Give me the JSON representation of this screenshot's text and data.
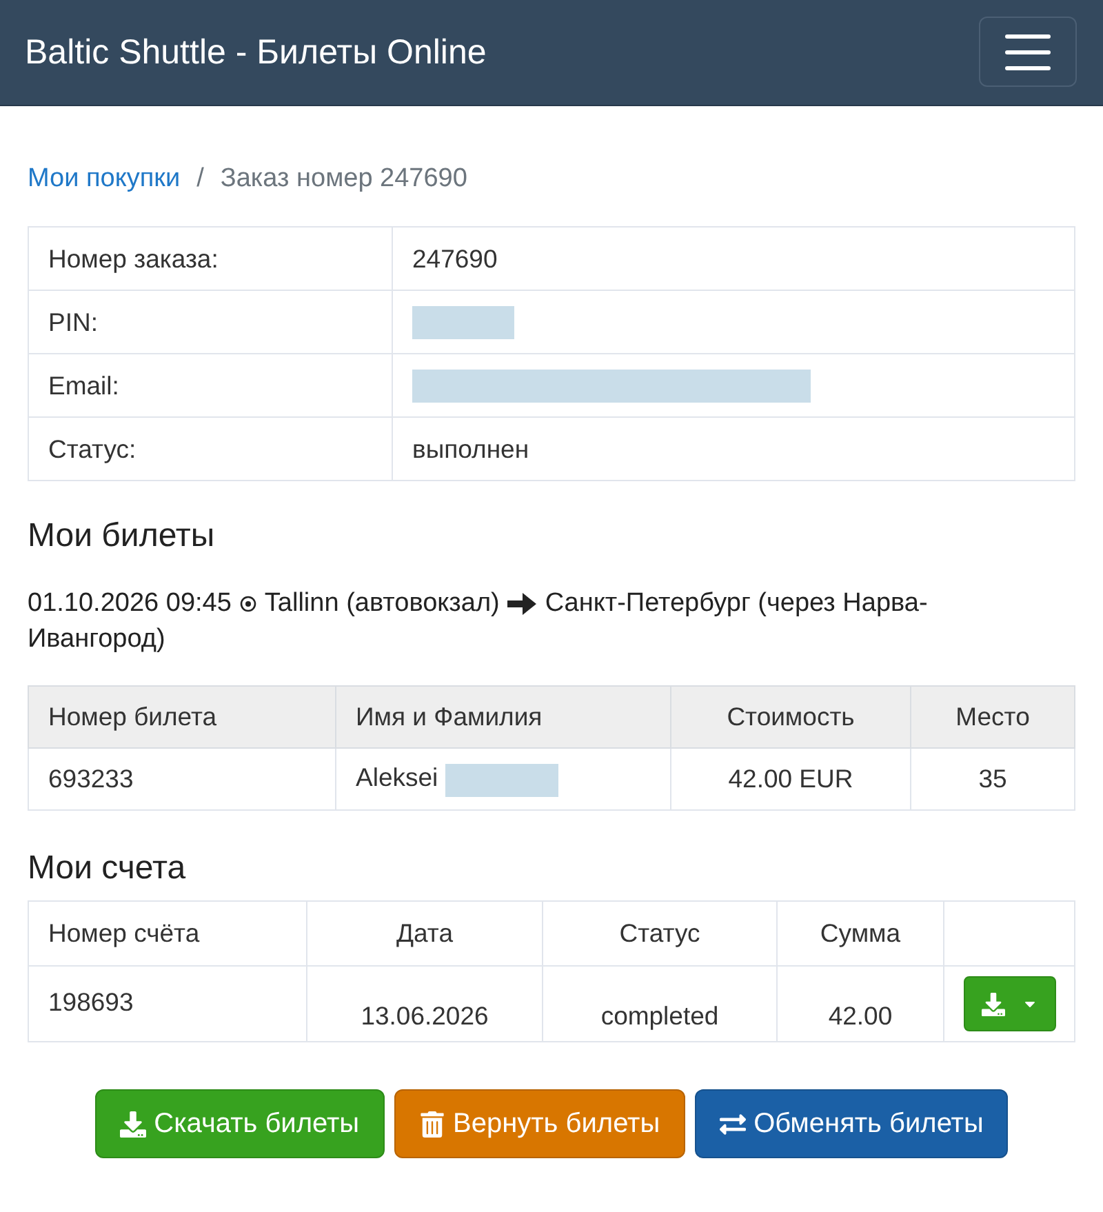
{
  "navbar": {
    "brand": "Baltic Shuttle - Билеты Online"
  },
  "breadcrumb": {
    "separator": "/",
    "items": [
      {
        "label": "Мои покупки",
        "kind": "link"
      },
      {
        "label": "Заказ номер 247690",
        "kind": "current"
      }
    ]
  },
  "order_info": [
    {
      "label": "Номер заказа:",
      "value": "247690",
      "masked": false
    },
    {
      "label": "PIN:",
      "masked": true
    },
    {
      "label": "Email:",
      "masked": true
    },
    {
      "label": "Статус:",
      "value": "выполнен",
      "masked": false
    }
  ],
  "tickets": {
    "heading": "Мои билеты",
    "trip": {
      "departure": "01.10.2026 09:45",
      "from": "Tallinn (автовокзал)",
      "to": "Санкт-Петербург (через Нарва-Ивангород)"
    },
    "columns": [
      "Номер билета",
      "Имя и Фамилия",
      "Стоимость",
      "Место"
    ],
    "rows": [
      {
        "ticket_no": "693233",
        "name": "Aleksei",
        "surname_masked": true,
        "price": "42.00 EUR",
        "seat": "35"
      }
    ]
  },
  "invoices": {
    "heading": "Мои счета",
    "columns": [
      "Номер счёта",
      "Дата",
      "Статус",
      "Сумма"
    ],
    "rows": [
      {
        "number": "198693",
        "date": "13.06.2026",
        "status": "completed",
        "amount": "42.00"
      }
    ]
  },
  "actions": [
    {
      "label": "Скачать билеты",
      "kind": "download"
    },
    {
      "label": "Вернуть билеты",
      "kind": "refund"
    },
    {
      "label": "Обменять билеты",
      "kind": "exchange"
    }
  ]
}
